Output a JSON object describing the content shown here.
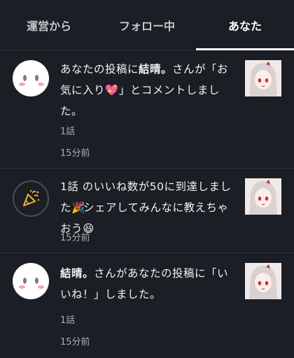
{
  "tabs": [
    {
      "label": "運営から"
    },
    {
      "label": "フォロー中"
    },
    {
      "label": "あなた"
    }
  ],
  "notifications": [
    {
      "text_before": "あなたの投稿に",
      "user": "結晴。",
      "text_after": "さんが「お気に入り",
      "text_after2": "」とコメントしました。",
      "heart": "💖",
      "episode": "1話",
      "time": "15分前"
    },
    {
      "text_main": "1話 のいいね数が50に到達しました",
      "party": "🎉",
      "text_cont": "シェアしてみんなに教えちゃおう",
      "smile": "😆",
      "time": "15分前"
    },
    {
      "user": "結晴。",
      "text_after": "さんがあなたの投稿に「いいね！」しました。",
      "episode": "1話",
      "time": "15分前"
    }
  ]
}
